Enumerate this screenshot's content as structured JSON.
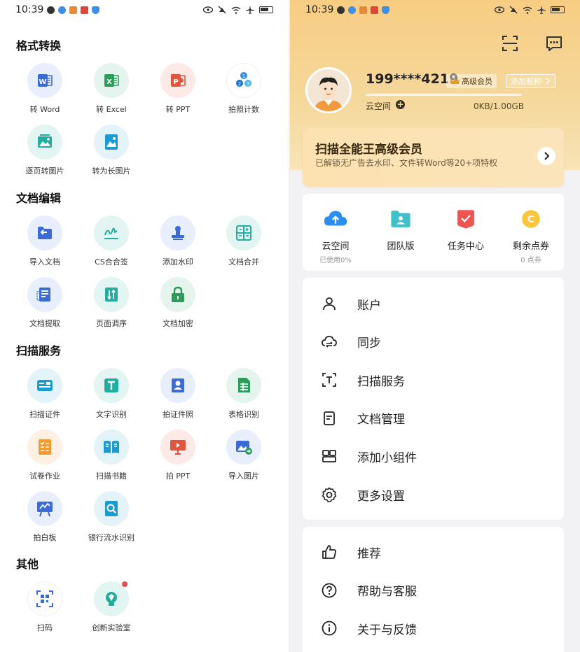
{
  "status_bar": {
    "time": "10:39"
  },
  "left": {
    "sections": [
      {
        "title": "格式转换",
        "items": [
          {
            "label": "转 Word",
            "icon": "word-icon",
            "bg": "#e8eefc",
            "fg": "#3b6bd6"
          },
          {
            "label": "转 Excel",
            "icon": "excel-icon",
            "bg": "#e5f4ec",
            "fg": "#2c9b5c"
          },
          {
            "label": "转 PPT",
            "icon": "ppt-icon",
            "bg": "#fde9e6",
            "fg": "#e3543f"
          },
          {
            "label": "拍照计数",
            "icon": "count-icon",
            "bg": "#fff",
            "fg": "#2d8fe3"
          },
          {
            "label": "逐页转图片",
            "icon": "image-icon",
            "bg": "#e3f5f3",
            "fg": "#21ae9f"
          },
          {
            "label": "转为长图片",
            "icon": "long-image-icon",
            "bg": "#e4f3fa",
            "fg": "#1b9bd1"
          }
        ]
      },
      {
        "title": "文档编辑",
        "items": [
          {
            "label": "导入文档",
            "icon": "import-doc-icon",
            "bg": "#e8eefc",
            "fg": "#3b6bd6"
          },
          {
            "label": "CS合合签",
            "icon": "signature-icon",
            "bg": "#e3f5f3",
            "fg": "#21ae9f"
          },
          {
            "label": "添加水印",
            "icon": "watermark-icon",
            "bg": "#e8eefc",
            "fg": "#3b6bd6"
          },
          {
            "label": "文档合并",
            "icon": "merge-icon",
            "bg": "#e3f5f3",
            "fg": "#21ae9f"
          },
          {
            "label": "文档提取",
            "icon": "extract-icon",
            "bg": "#e8eefc",
            "fg": "#3b6bd6"
          },
          {
            "label": "页面调序",
            "icon": "reorder-icon",
            "bg": "#e3f5f3",
            "fg": "#21ae9f"
          },
          {
            "label": "文档加密",
            "icon": "lock-icon",
            "bg": "#e5f4ec",
            "fg": "#2c9b5c"
          }
        ]
      },
      {
        "title": "扫描服务",
        "items": [
          {
            "label": "扫描证件",
            "icon": "id-card-icon",
            "bg": "#e4f3fa",
            "fg": "#1b9bd1"
          },
          {
            "label": "文字识别",
            "icon": "text-recognition-icon",
            "bg": "#e3f5f3",
            "fg": "#21ae9f"
          },
          {
            "label": "拍证件照",
            "icon": "id-photo-icon",
            "bg": "#e8eefc",
            "fg": "#3b6bd6"
          },
          {
            "label": "表格识别",
            "icon": "table-recognition-icon",
            "bg": "#e5f4ec",
            "fg": "#2c9b5c"
          },
          {
            "label": "试卷作业",
            "icon": "exam-icon",
            "bg": "#fef1e4",
            "fg": "#f39a2b"
          },
          {
            "label": "扫描书籍",
            "icon": "book-icon",
            "bg": "#e4f3fa",
            "fg": "#1b9bd1"
          },
          {
            "label": "拍 PPT",
            "icon": "ppt-photo-icon",
            "bg": "#fde9e6",
            "fg": "#e3543f"
          },
          {
            "label": "导入图片",
            "icon": "import-image-icon",
            "bg": "#e8eefc",
            "fg": "#3b6bd6"
          },
          {
            "label": "拍白板",
            "icon": "whiteboard-icon",
            "bg": "#e8eefc",
            "fg": "#3b6bd6"
          },
          {
            "label": "银行流水识别",
            "icon": "bank-statement-icon",
            "bg": "#e4f3fa",
            "fg": "#1b9bd1"
          }
        ]
      },
      {
        "title": "其他",
        "items": [
          {
            "label": "扫码",
            "icon": "qr-scan-icon",
            "bg": "#fff",
            "fg": "#3b6bd6"
          },
          {
            "label": "创新实验室",
            "icon": "lab-icon",
            "bg": "#e3f5f3",
            "fg": "#21ae9f"
          }
        ]
      }
    ]
  },
  "right": {
    "profile": {
      "phone": "199****4219",
      "vip_badge": "高级会员",
      "nickname_btn": "添加昵称",
      "cloud_label": "云空间",
      "storage": "0KB/1.00GB"
    },
    "vip_card": {
      "title": "扫描全能王高级会员",
      "subtitle": "已解锁无广告去水印、文件转Word等20+项特权"
    },
    "features": [
      {
        "title": "云空间",
        "sub": "已使用0%",
        "icon": "cloud-upload-icon"
      },
      {
        "title": "团队版",
        "sub": "",
        "icon": "team-icon"
      },
      {
        "title": "任务中心",
        "sub": "",
        "icon": "task-icon"
      },
      {
        "title": "剩余点券",
        "sub": "0 点券",
        "icon": "coupon-icon"
      }
    ],
    "menu1": [
      {
        "label": "账户",
        "icon": "user-icon"
      },
      {
        "label": "同步",
        "icon": "sync-icon"
      },
      {
        "label": "扫描服务",
        "icon": "scan-text-icon"
      },
      {
        "label": "文档管理",
        "icon": "document-icon"
      },
      {
        "label": "添加小组件",
        "icon": "widget-icon"
      },
      {
        "label": "更多设置",
        "icon": "settings-icon"
      }
    ],
    "menu2": [
      {
        "label": "推荐",
        "icon": "thumbs-up-icon"
      },
      {
        "label": "帮助与客服",
        "icon": "help-icon"
      },
      {
        "label": "关于与反馈",
        "icon": "info-icon"
      }
    ]
  }
}
